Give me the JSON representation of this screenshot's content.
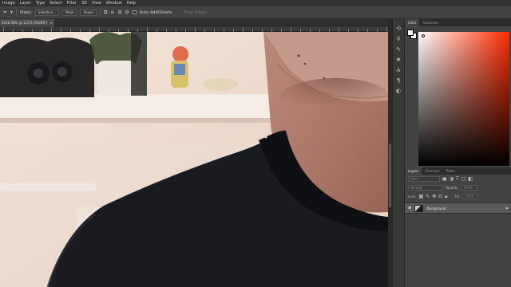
{
  "menu": [
    "Image",
    "Layer",
    "Type",
    "Select",
    "Filter",
    "3D",
    "View",
    "Window",
    "Help"
  ],
  "options": {
    "make_label": "Make:",
    "selection_label": "Selection...",
    "mask_label": "Mask",
    "shape_label": "Shape",
    "auto_add_label": "Auto Add/Delete",
    "align_edges_label": "Align Edges"
  },
  "document": {
    "tab_title": "5036.RW2 @ 122% (RGB/8*)",
    "close_symbol": "×"
  },
  "panels": {
    "color_tabs": [
      "Color",
      "Swatches"
    ],
    "layers_tabs": [
      "Layers",
      "Channels",
      "Paths"
    ],
    "kind_placeholder": "Kind",
    "blend_mode": "Normal",
    "opacity_label": "Opacity:",
    "opacity_value": "100%",
    "lock_label": "Lock:",
    "fill_label": "Fill:",
    "fill_value": "100%",
    "layer_name": "Background"
  },
  "colors": {
    "fg": "#ffffff",
    "bg": "#ffffff",
    "hue": "#ff2a00"
  },
  "icons": {
    "move": "move-icon",
    "pen": "pen-tool-icon",
    "eye": "eye-icon",
    "lock": "lock-icon"
  }
}
